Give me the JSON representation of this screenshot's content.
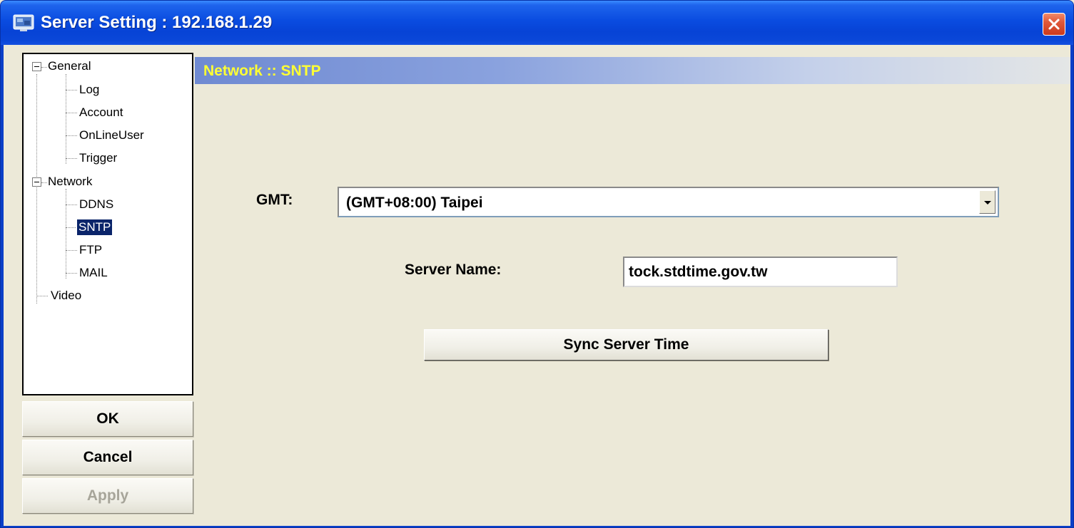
{
  "window": {
    "title": "Server Setting : 192.168.1.29",
    "icon": "app-monitor-icon",
    "close_icon": "close-icon"
  },
  "tree": {
    "general": {
      "label": "General",
      "children": [
        "Log",
        "Account",
        "OnLineUser",
        "Trigger"
      ]
    },
    "network": {
      "label": "Network",
      "children": [
        "DDNS",
        "SNTP",
        "FTP",
        "MAIL"
      ],
      "selected": "SNTP"
    },
    "video": {
      "label": "Video"
    }
  },
  "buttons": {
    "ok": "OK",
    "cancel": "Cancel",
    "apply": "Apply"
  },
  "panel": {
    "section_title": "Network :: SNTP",
    "gmt_label": "GMT:",
    "gmt_value": "(GMT+08:00) Taipei",
    "server_name_label": "Server Name:",
    "server_name_value": "tock.stdtime.gov.tw",
    "sync_button": "Sync Server Time"
  },
  "colors": {
    "title_bar": "#0a4ce0",
    "section_title_text": "#ffff33",
    "selection": "#0a246a",
    "dialog_bg": "#ece9d8"
  }
}
